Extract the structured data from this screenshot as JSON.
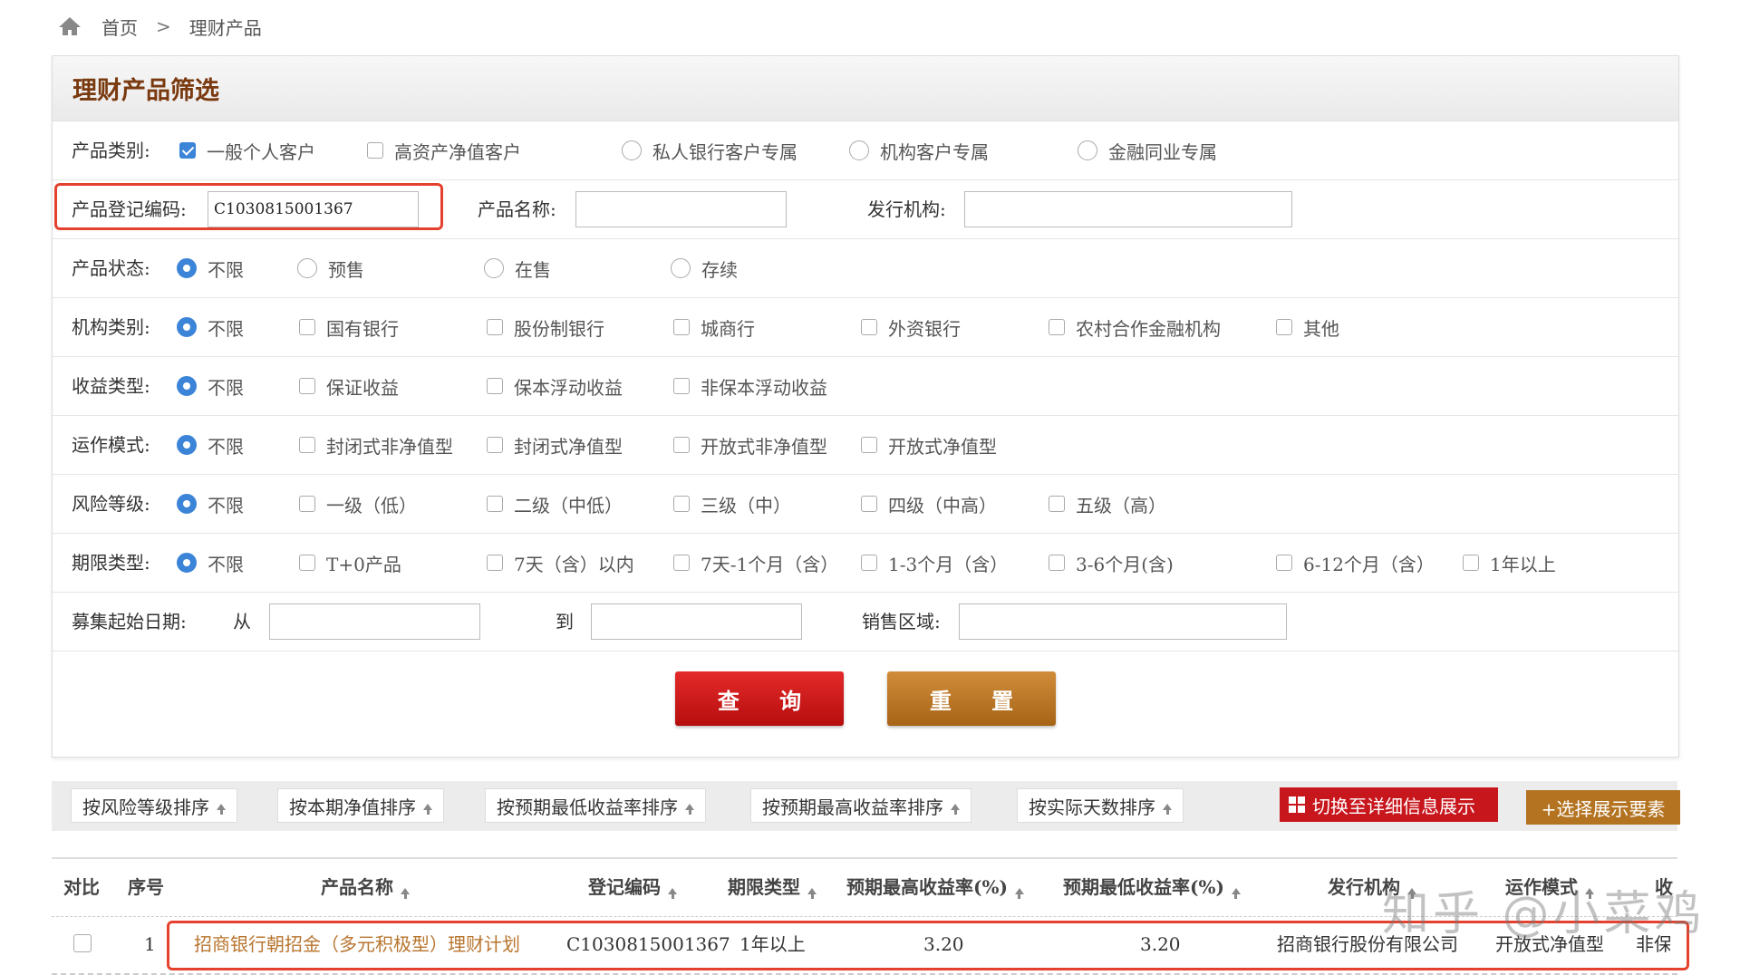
{
  "breadcrumb": {
    "home": "首页",
    "separator": ">",
    "current": "理财产品"
  },
  "panel": {
    "title": "理财产品筛选"
  },
  "filters": {
    "category": {
      "label": "产品类别:",
      "options": [
        "一般个人客户",
        "高资产净值客户",
        "私人银行客户专属",
        "机构客户专属",
        "金融同业专属"
      ]
    },
    "reg": {
      "label": "产品登记编码:",
      "value": "C1030815001367",
      "name_label": "产品名称:",
      "name_value": "",
      "issuer_label": "发行机构:",
      "issuer_value": ""
    },
    "status": {
      "label": "产品状态:",
      "options": [
        "不限",
        "预售",
        "在售",
        "存续"
      ]
    },
    "org": {
      "label": "机构类别:",
      "options": [
        "不限",
        "国有银行",
        "股份制银行",
        "城商行",
        "外资银行",
        "农村合作金融机构",
        "其他"
      ]
    },
    "yield": {
      "label": "收益类型:",
      "options": [
        "不限",
        "保证收益",
        "保本浮动收益",
        "非保本浮动收益"
      ]
    },
    "mode": {
      "label": "运作模式:",
      "options": [
        "不限",
        "封闭式非净值型",
        "封闭式净值型",
        "开放式非净值型",
        "开放式净值型"
      ]
    },
    "risk": {
      "label": "风险等级:",
      "options": [
        "不限",
        "一级（低）",
        "二级（中低）",
        "三级（中）",
        "四级（中高）",
        "五级（高）"
      ]
    },
    "term": {
      "label": "期限类型:",
      "options": [
        "不限",
        "T+0产品",
        "7天（含）以内",
        "7天-1个月（含）",
        "1-3个月（含）",
        "3-6个月(含)",
        "6-12个月（含）",
        "1年以上"
      ]
    },
    "date": {
      "label": "募集起始日期:",
      "from": "从",
      "to": "到",
      "from_value": "",
      "to_value": "",
      "region_label": "销售区域:",
      "region_value": ""
    }
  },
  "buttons": {
    "query": "查 询",
    "reset": "重 置"
  },
  "sortbar": {
    "items": [
      "按风险等级排序",
      "按本期净值排序",
      "按预期最低收益率排序",
      "按预期最高收益率排序",
      "按实际天数排序"
    ],
    "switch": "切换至详细信息展示",
    "add": "+选择展示要素"
  },
  "table": {
    "headers": [
      "对比",
      "序号",
      "产品名称",
      "登记编码",
      "期限类型",
      "预期最高收益率(%)",
      "预期最低收益率(%)",
      "发行机构",
      "运作模式",
      "收"
    ],
    "rows": [
      [
        "",
        "1",
        "招商银行朝招金（多元积极型）理财计划",
        "C1030815001367",
        "1年以上",
        "3.20",
        "3.20",
        "招商银行股份有限公司",
        "开放式净值型",
        "非保"
      ]
    ]
  },
  "watermark": "知乎 @小菜鸡",
  "colors": {
    "accent_red": "#c8161d",
    "accent_gold": "#b37321",
    "title_brown": "#7a3a10",
    "link_brown": "#b8752f",
    "check_blue": "#3b84d8",
    "highlight": "#e5412f"
  }
}
